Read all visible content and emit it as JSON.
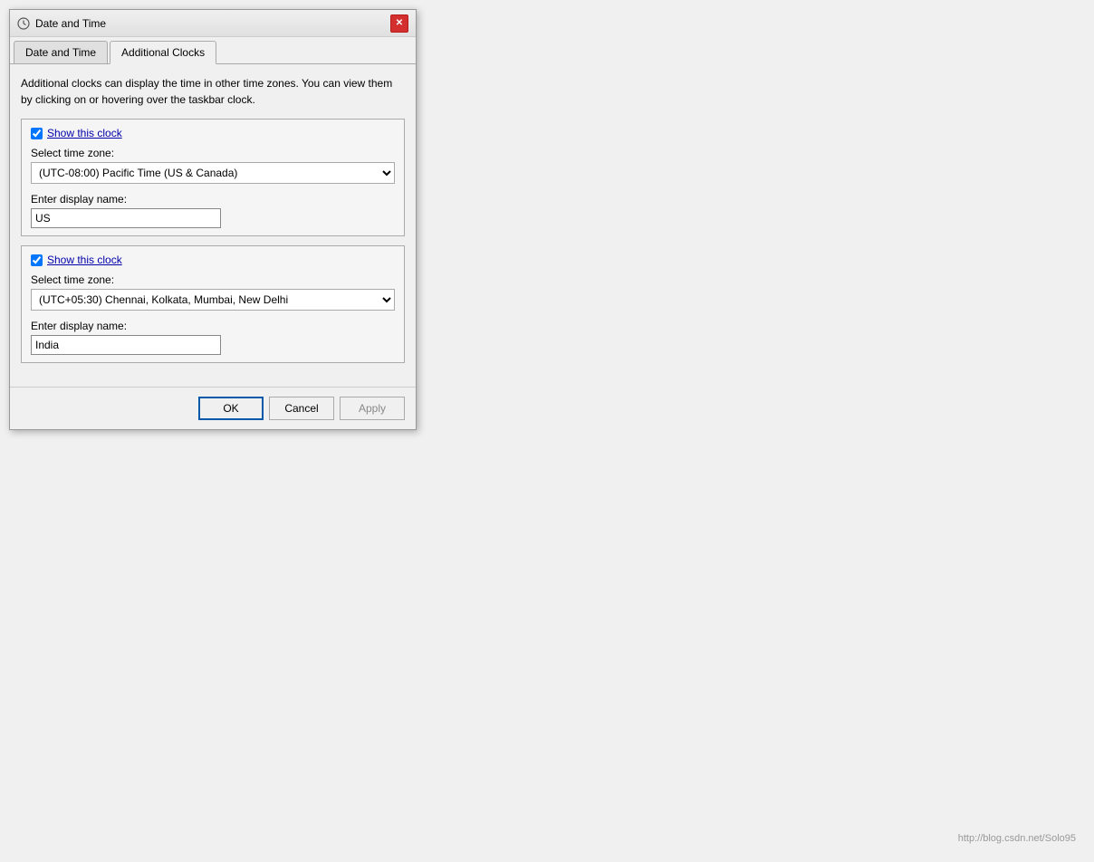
{
  "window": {
    "title": "Date and Time",
    "close_label": "✕"
  },
  "tabs": [
    {
      "id": "date-time",
      "label": "Date and Time",
      "active": false
    },
    {
      "id": "additional-clocks",
      "label": "Additional Clocks",
      "active": true
    }
  ],
  "additional_clocks": {
    "description": "Additional clocks can display the time in other time zones. You can view them by clicking on or hovering over the taskbar clock.",
    "clock1": {
      "show_checked": true,
      "show_label": "Show this clock",
      "timezone_label": "Select time zone:",
      "timezone_value": "(UTC-08:00) Pacific Time (US & Canada)",
      "display_name_label": "Enter display name:",
      "display_name_value": "US"
    },
    "clock2": {
      "show_checked": true,
      "show_label": "Show this clock",
      "timezone_label": "Select time zone:",
      "timezone_value": "(UTC+05:30) Chennai, Kolkata, Mumbai, New Delhi",
      "display_name_label": "Enter display name:",
      "display_name_value": "India"
    }
  },
  "footer": {
    "ok_label": "OK",
    "cancel_label": "Cancel",
    "apply_label": "Apply"
  },
  "watermark": "http://blog.csdn.net/Solo95"
}
